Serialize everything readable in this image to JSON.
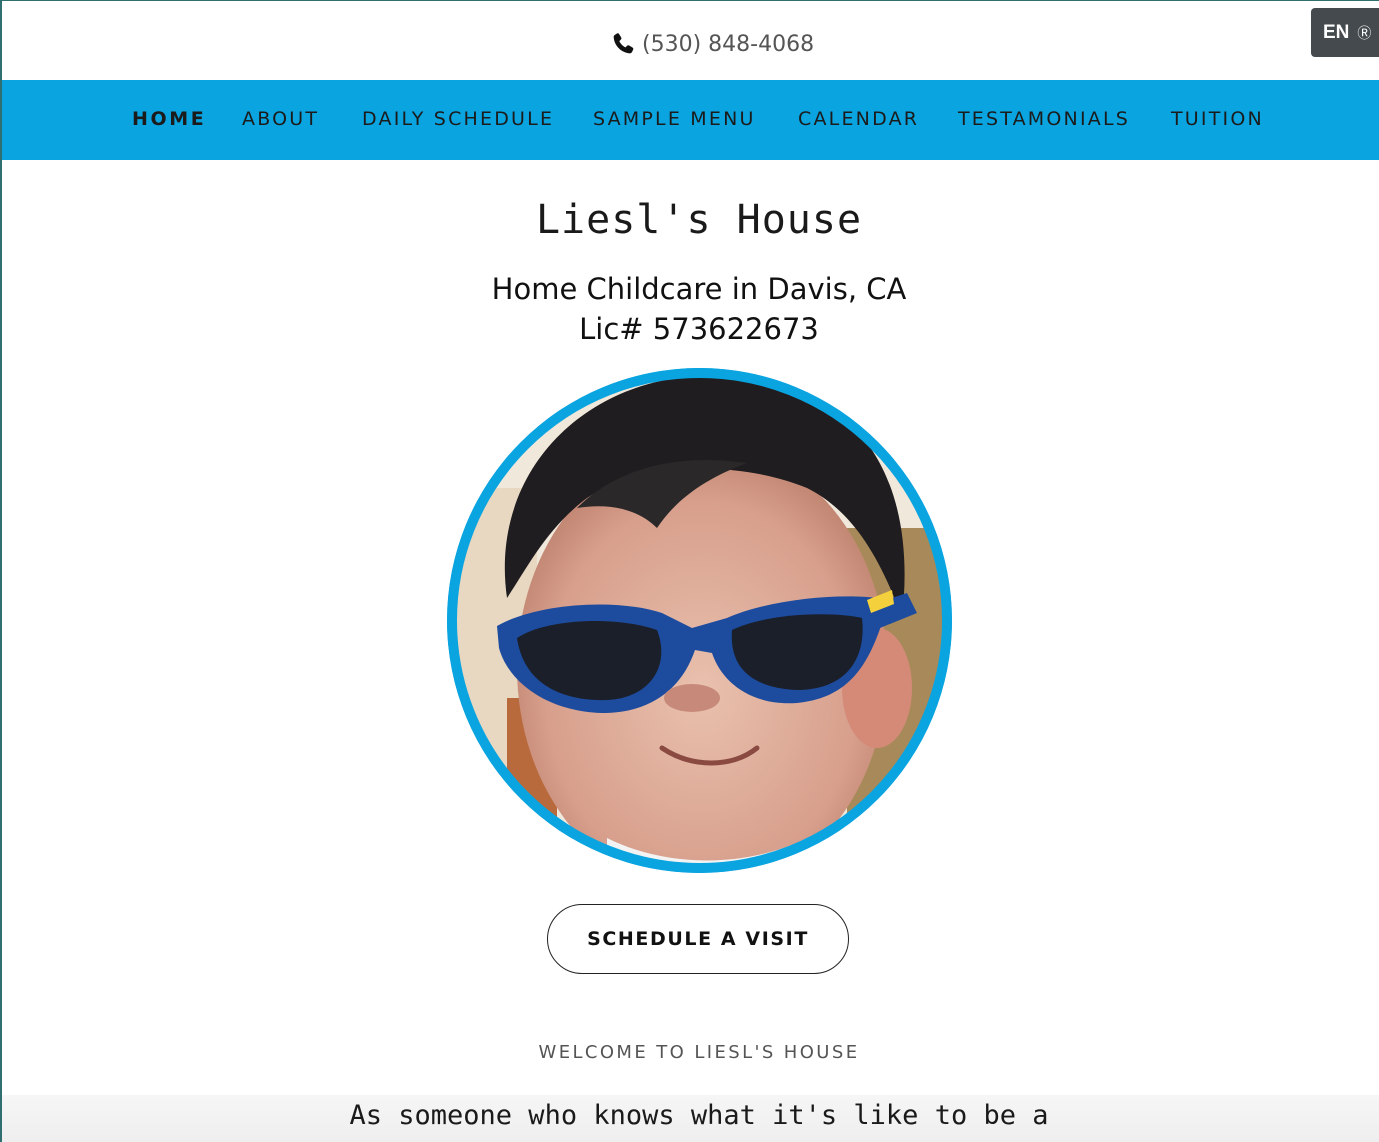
{
  "header": {
    "phone": "(530) 848-4068",
    "language": "EN",
    "language_icon": "globe-icon"
  },
  "nav": {
    "items": [
      {
        "label": "HOME",
        "active": true
      },
      {
        "label": "ABOUT",
        "active": false
      },
      {
        "label": "DAILY SCHEDULE",
        "active": false
      },
      {
        "label": "SAMPLE MENU",
        "active": false
      },
      {
        "label": "CALENDAR",
        "active": false
      },
      {
        "label": "TESTAMONIALS",
        "active": false
      },
      {
        "label": "TUITION",
        "active": false
      }
    ]
  },
  "hero": {
    "title": "Liesl's House",
    "subtitle_line1": "Home Childcare in Davis, CA",
    "subtitle_line2": "Lic# 573622673",
    "cta_label": "SCHEDULE A VISIT"
  },
  "welcome": {
    "heading": "WELCOME TO LIESL'S HOUSE",
    "intro": "As someone who knows what it's like to be a"
  },
  "colors": {
    "accent": "#0aa4e0",
    "text": "#1b1b1b",
    "lang_bg": "#444a4d"
  }
}
